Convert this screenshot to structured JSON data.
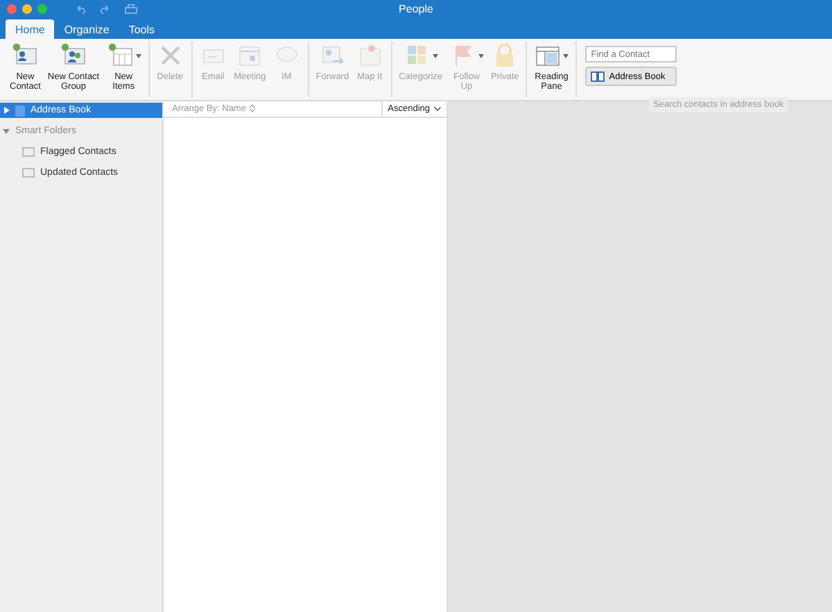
{
  "window": {
    "title": "People"
  },
  "tabs": [
    {
      "label": "Home",
      "selected": true
    },
    {
      "label": "Organize",
      "selected": false
    },
    {
      "label": "Tools",
      "selected": false
    }
  ],
  "ribbon": {
    "groups": [
      [
        {
          "label": "New\nContact",
          "disabled": false,
          "dropdown": false
        },
        {
          "label": "New Contact\nGroup",
          "disabled": false,
          "dropdown": false
        },
        {
          "label": "New\nItems",
          "disabled": false,
          "dropdown": true
        }
      ],
      [
        {
          "label": "Delete",
          "disabled": true,
          "dropdown": false
        }
      ],
      [
        {
          "label": "Email",
          "disabled": true,
          "dropdown": false
        },
        {
          "label": "Meeting",
          "disabled": true,
          "dropdown": false
        },
        {
          "label": "IM",
          "disabled": true,
          "dropdown": false
        }
      ],
      [
        {
          "label": "Forward",
          "disabled": true,
          "dropdown": false
        },
        {
          "label": "Map It",
          "disabled": true,
          "dropdown": false
        }
      ],
      [
        {
          "label": "Categorize",
          "disabled": true,
          "dropdown": true
        },
        {
          "label": "Follow\nUp",
          "disabled": true,
          "dropdown": true
        },
        {
          "label": "Private",
          "disabled": true,
          "dropdown": false
        }
      ],
      [
        {
          "label": "Reading\nPane",
          "disabled": false,
          "dropdown": true
        }
      ]
    ],
    "search": {
      "placeholder": "Find a Contact"
    },
    "address_book_button": "Address Book",
    "tooltip": "Search contacts in address book"
  },
  "sidebar": {
    "items": [
      {
        "label": "Address Book",
        "selected": true,
        "expanded": false
      },
      {
        "label": "Smart Folders",
        "selected": false,
        "expanded": true,
        "children": [
          {
            "label": "Flagged Contacts",
            "selected": false
          },
          {
            "label": "Updated Contacts",
            "selected": false
          }
        ]
      }
    ]
  },
  "list": {
    "arrange_by": "Arrange By: Name",
    "order": "Ascending"
  }
}
